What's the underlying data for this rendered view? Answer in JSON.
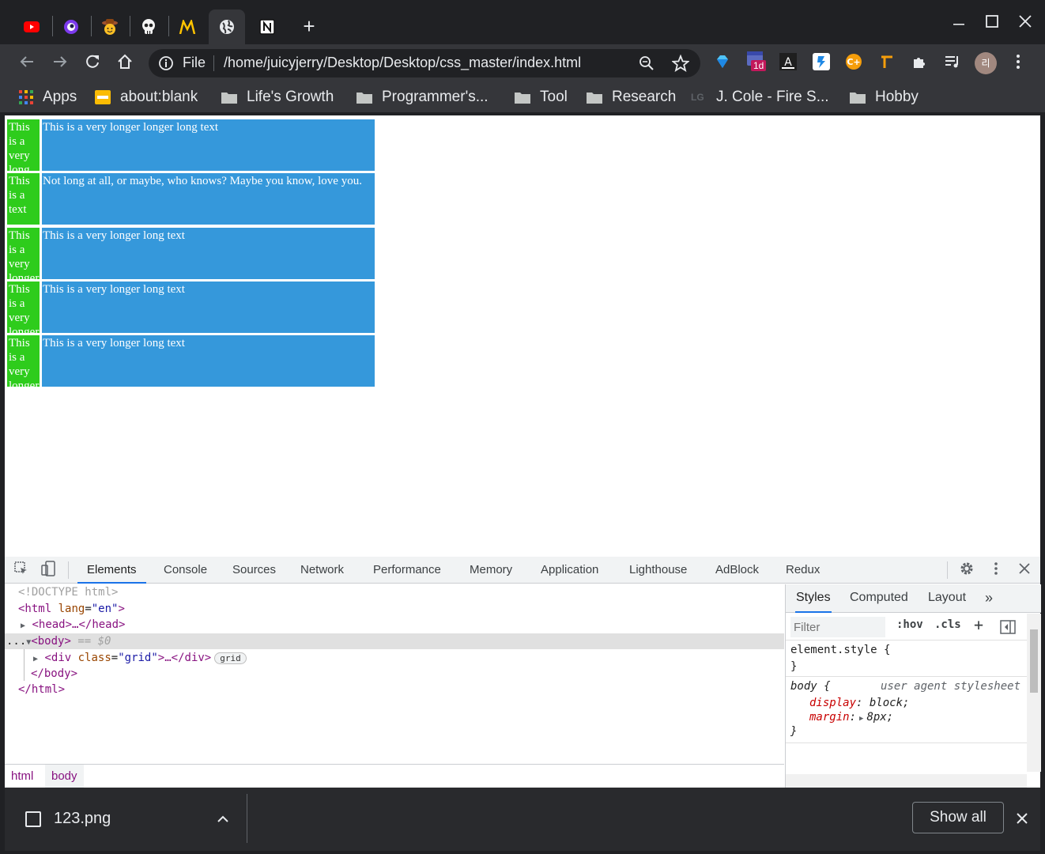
{
  "browser": {
    "tabs": [
      {
        "icon": "youtube-icon"
      },
      {
        "icon": "circle-logo-icon"
      },
      {
        "icon": "cowboy-emoji-icon"
      },
      {
        "icon": "skull-icon"
      },
      {
        "icon": "mcdonalds-icon"
      },
      {
        "icon": "globe-icon",
        "active": true
      },
      {
        "icon": "notion-icon"
      }
    ],
    "new_tab": "+",
    "omnibox": {
      "scheme_label": "File",
      "url": "/home/juicyjerry/Desktop/Desktop/css_master/index.html"
    },
    "profile_initial": "리",
    "extension_badge": "1d",
    "bookmarks": [
      {
        "label": "Apps",
        "icon": "apps-grid-icon"
      },
      {
        "label": "about:blank",
        "icon": "page-icon"
      },
      {
        "label": "Life's Growth",
        "icon": "folder-icon"
      },
      {
        "label": "Programmer's...",
        "icon": "folder-icon"
      },
      {
        "label": "Tool",
        "icon": "folder-icon"
      },
      {
        "label": "Research",
        "icon": "folder-icon"
      },
      {
        "label": "J. Cole - Fire S...",
        "icon": "lg-logo-icon",
        "logo_text": "LG"
      },
      {
        "label": "Hobby",
        "icon": "folder-icon"
      }
    ]
  },
  "page": {
    "rows": [
      {
        "left": "This is a very long",
        "right": "This is a very longer longer long text"
      },
      {
        "left": "This is a text",
        "right": "Not long at all, or maybe, who knows? Maybe you know, love you."
      },
      {
        "left": "This is a very longer",
        "right": "This is a very longer long text"
      },
      {
        "left": "This is a very longer",
        "right": "This is a very longer long text"
      },
      {
        "left": "This is a very longer",
        "right": "This is a very longer long text"
      }
    ],
    "colors": {
      "left_cell": "#2ecc1c",
      "right_cell": "#3598db"
    }
  },
  "devtools": {
    "tabs": [
      "Elements",
      "Console",
      "Sources",
      "Network",
      "Performance",
      "Memory",
      "Application",
      "Lighthouse",
      "AdBlock",
      "Redux"
    ],
    "active_tab": "Elements",
    "dom": {
      "doctype": "<!DOCTYPE html>",
      "html_open_tag": "<html",
      "lang_attr": "lang",
      "lang_val": "\"en\"",
      "head": "<head>…</head>",
      "body_open": "<body>",
      "body_selected_marker": "== $0",
      "div_open": "<div",
      "div_class_attr": "class",
      "div_class_val": "\"grid\"",
      "div_close": ">…</div>",
      "grid_badge": "grid",
      "body_close": "</body>",
      "html_close": "</html>",
      "ellipsis": "..."
    },
    "breadcrumbs": [
      "html",
      "body"
    ],
    "side_tabs": [
      "Styles",
      "Computed",
      "Layout"
    ],
    "side_more": "»",
    "filter_placeholder": "Filter",
    "hov": ":hov",
    "cls": ".cls",
    "plus": "+",
    "styles": {
      "element_style_selector": "element.style {",
      "close_brace": "}",
      "body_selector": "body {",
      "ua_label": "user agent stylesheet",
      "display_prop": "display",
      "display_val": "block;",
      "margin_prop": "margin",
      "margin_val": "8px;"
    }
  },
  "download": {
    "file": "123.png",
    "show_all": "Show all"
  }
}
